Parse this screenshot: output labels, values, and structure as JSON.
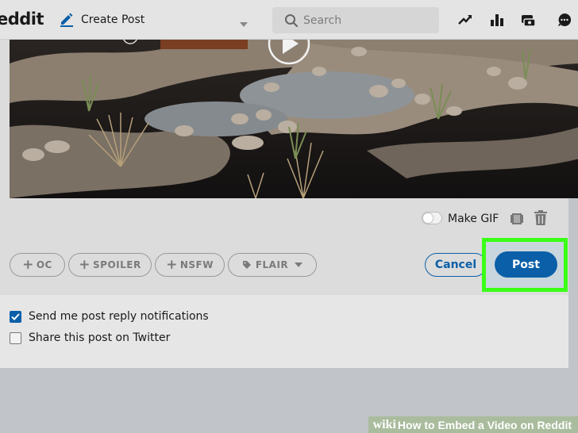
{
  "header": {
    "logo_text": "eddit",
    "create_post_label": "Create Post",
    "search_placeholder": "Search",
    "icons": [
      "trending-icon",
      "stats-icon",
      "coins-icon",
      "chat-icon"
    ]
  },
  "media": {
    "make_gif_label": "Make GIF",
    "make_gif_enabled": false
  },
  "tags": {
    "oc": "OC",
    "spoiler": "SPOILER",
    "nsfw": "NSFW",
    "flair": "FLAIR"
  },
  "actions": {
    "cancel_label": "Cancel",
    "post_label": "Post"
  },
  "options": {
    "notify_label": "Send me post reply notifications",
    "notify_checked": true,
    "twitter_label": "Share this post on Twitter",
    "twitter_checked": false
  },
  "watermark": {
    "brand": "wiki",
    "text": "How to Embed a Video on Reddit"
  },
  "colors": {
    "accent": "#0a5fa8",
    "highlight": "#3aff16"
  }
}
